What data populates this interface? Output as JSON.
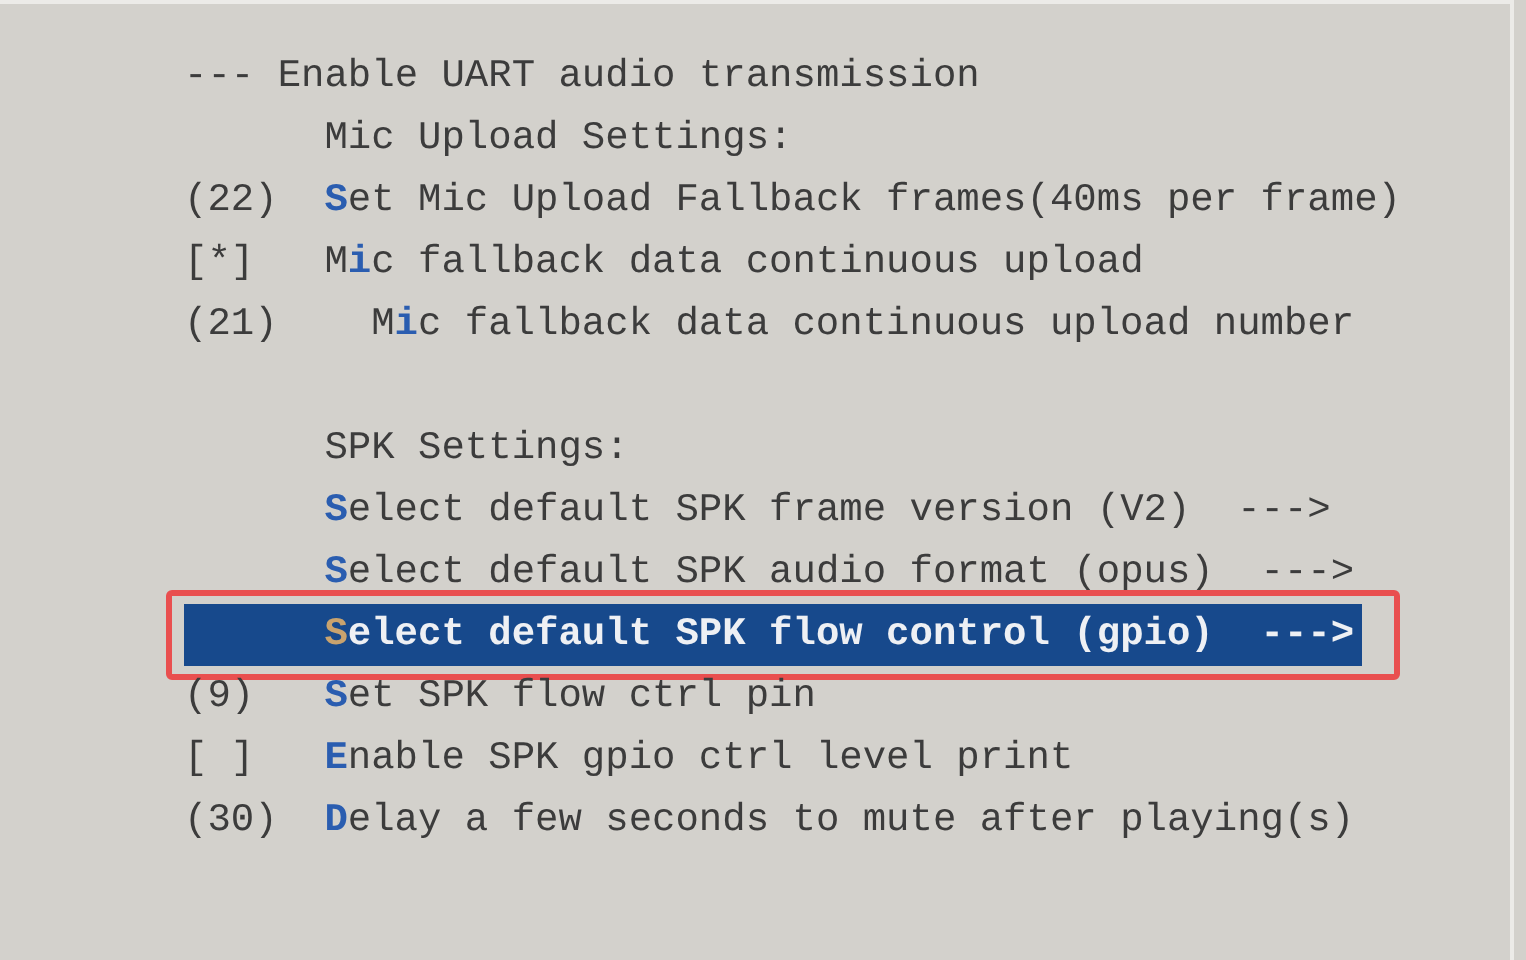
{
  "items": [
    {
      "kind": "header",
      "prefix": "---",
      "post": "Enable UART audio transmission"
    },
    {
      "kind": "comment",
      "post": "Mic Upload Settings:"
    },
    {
      "kind": "int",
      "prefix": "(22)",
      "key": "S",
      "post": "et Mic Upload Fallback frames(40ms per frame)",
      "selected": false
    },
    {
      "kind": "bool",
      "prefix": "[*]",
      "pre": "M",
      "key": "i",
      "post": "c fallback data continuous upload",
      "selected": false,
      "children": [
        {
          "kind": "int",
          "prefix": "(21)",
          "pre": "M",
          "key": "i",
          "post": "c fallback data continuous upload number",
          "selected": false
        }
      ]
    },
    {
      "kind": "blank"
    },
    {
      "kind": "comment",
      "post": "SPK Settings:"
    },
    {
      "kind": "menu",
      "key": "S",
      "post": "elect default SPK frame version (V2)",
      "suffix": "--->",
      "selected": false
    },
    {
      "kind": "menu",
      "key": "S",
      "post": "elect default SPK audio format (opus)",
      "suffix": "--->",
      "selected": false
    },
    {
      "kind": "menu",
      "key": "S",
      "post": "elect default SPK flow control (gpio)",
      "suffix": "--->",
      "selected": true,
      "outlined": true
    },
    {
      "kind": "int",
      "prefix": "(9)",
      "key": "S",
      "post": "et SPK flow ctrl pin",
      "selected": false
    },
    {
      "kind": "bool",
      "prefix": "[ ]",
      "key": "E",
      "post": "nable SPK gpio ctrl level print",
      "selected": false
    },
    {
      "kind": "int",
      "prefix": "(30)",
      "key": "D",
      "post": "elay a few seconds to mute after playing(s)",
      "selected": false
    }
  ]
}
